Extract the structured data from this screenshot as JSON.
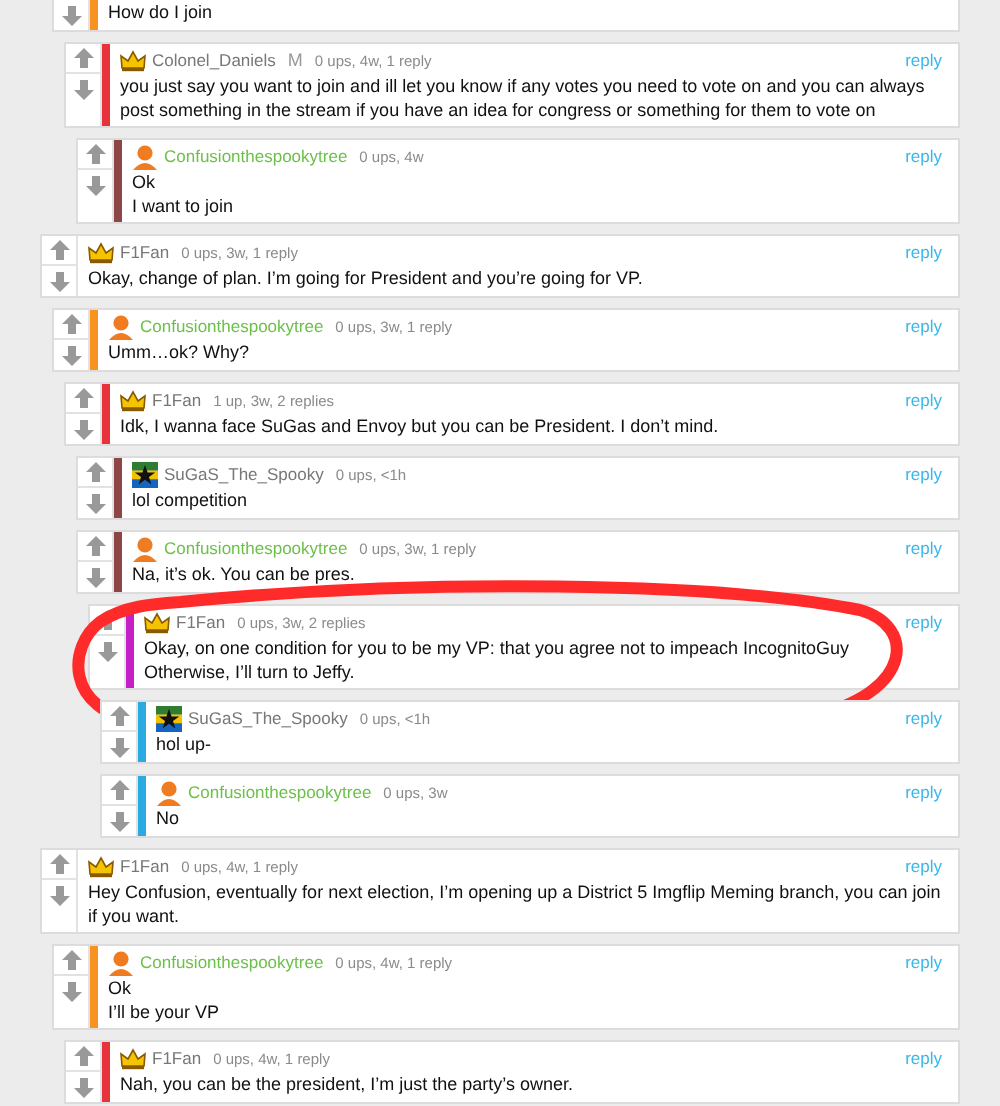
{
  "comments": [
    {
      "kind": "continued",
      "children": [
        {
          "kind": "cut",
          "body": "How do I join",
          "children": [
            {
              "kind": "full",
              "author": "Colonel_Daniels",
              "avatar": {
                "kind": "crown"
              },
              "name_highlighted": false,
              "badge": "M",
              "meta": "0 ups, 4w, 1 reply",
              "reply": "reply",
              "body": "you just say you want to join and ill let you know if any votes you need to vote on and you can always post something in the stream if you have an idea for congress or something for them to vote on",
              "children": [
                {
                  "kind": "full",
                  "author": "Confusionthespookytree",
                  "avatar": {
                    "kind": "person"
                  },
                  "name_highlighted": true,
                  "meta": "0 ups, 4w",
                  "reply": "reply",
                  "body": "Ok\nI want to join"
                }
              ]
            }
          ]
        }
      ]
    },
    {
      "kind": "full",
      "author": "F1Fan",
      "avatar": {
        "kind": "crown"
      },
      "name_highlighted": false,
      "meta": "0 ups, 3w, 1 reply",
      "reply": "reply",
      "body": "Okay, change of plan. I’m going for President and you’re going for VP.",
      "children": [
        {
          "kind": "full",
          "author": "Confusionthespookytree",
          "avatar": {
            "kind": "person"
          },
          "name_highlighted": true,
          "meta": "0 ups, 3w, 1 reply",
          "reply": "reply",
          "body": "Umm…ok? Why?",
          "children": [
            {
              "kind": "full",
              "author": "F1Fan",
              "avatar": {
                "kind": "crown"
              },
              "name_highlighted": false,
              "meta": "1 up, 3w, 2 replies",
              "reply": "reply",
              "body": "Idk, I wanna face SuGas and Envoy but you can be President. I don’t mind.",
              "children": [
                {
                  "kind": "full",
                  "author": "SuGaS_The_Spooky",
                  "avatar": {
                    "kind": "flag"
                  },
                  "name_highlighted": false,
                  "meta": "0 ups, <1h",
                  "reply": "reply",
                  "body": "lol competition"
                },
                {
                  "kind": "full",
                  "author": "Confusionthespookytree",
                  "avatar": {
                    "kind": "person"
                  },
                  "name_highlighted": true,
                  "meta": "0 ups, 3w, 1 reply",
                  "reply": "reply",
                  "body": "Na, it’s ok. You can be pres.",
                  "children": [
                    {
                      "kind": "full",
                      "author": "F1Fan",
                      "avatar": {
                        "kind": "crown"
                      },
                      "name_highlighted": false,
                      "meta": "0 ups, 3w, 2 replies",
                      "reply": "reply",
                      "circled": true,
                      "body": "Okay, on one condition for you to be my VP: that you agree not to impeach IncognitoGuy\nOtherwise, I’ll turn to Jeffy.",
                      "children": [
                        {
                          "kind": "full",
                          "author": "SuGaS_The_Spooky",
                          "avatar": {
                            "kind": "flag"
                          },
                          "name_highlighted": false,
                          "meta": "0 ups, <1h",
                          "reply": "reply",
                          "body": "hol up-"
                        },
                        {
                          "kind": "full",
                          "author": "Confusionthespookytree",
                          "avatar": {
                            "kind": "person"
                          },
                          "name_highlighted": true,
                          "meta": "0 ups, 3w",
                          "reply": "reply",
                          "body": "No"
                        }
                      ]
                    }
                  ]
                }
              ]
            }
          ]
        }
      ]
    },
    {
      "kind": "full",
      "author": "F1Fan",
      "avatar": {
        "kind": "crown"
      },
      "name_highlighted": false,
      "meta": "0 ups, 4w, 1 reply",
      "reply": "reply",
      "body": "Hey Confusion, eventually for next election, I’m opening up a District 5 Imgflip Meming branch, you can join if you want.",
      "children": [
        {
          "kind": "full",
          "author": "Confusionthespookytree",
          "avatar": {
            "kind": "person"
          },
          "name_highlighted": true,
          "meta": "0 ups, 4w, 1 reply",
          "reply": "reply",
          "body": "Ok\nI’ll be your VP",
          "children": [
            {
              "kind": "full",
              "author": "F1Fan",
              "avatar": {
                "kind": "crown"
              },
              "name_highlighted": false,
              "meta": "0 ups, 4w, 1 reply",
              "reply": "reply",
              "body": "Nah, you can be the president, I’m just the party’s owner."
            }
          ]
        }
      ]
    }
  ]
}
